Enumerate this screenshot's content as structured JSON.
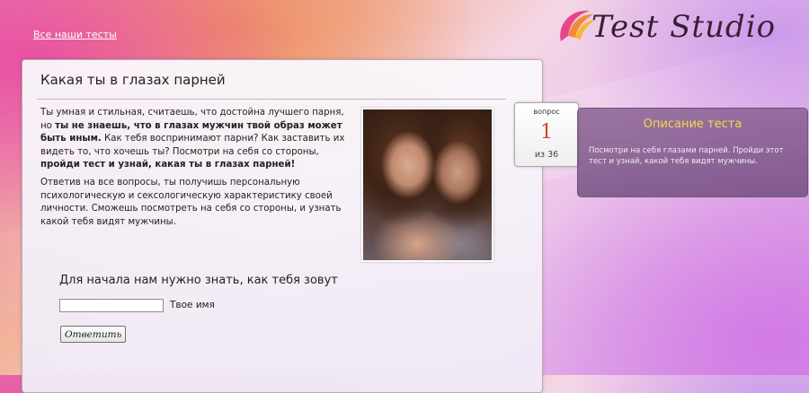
{
  "header": {
    "all_tests_link": "Все наши тесты",
    "logo_text": "Test Studio"
  },
  "main": {
    "title": "Какая ты в глазах парней",
    "intro_parts": [
      "Ты умная и стильная, считаешь, что достойна лучшего парня, но ",
      "ты не знаешь, что в глазах мужчин твой образ может быть иным.",
      " Как тебя воспринимают парни? Как заставить их видеть то, что хочешь ты? Посмотри на себя со стороны, ",
      "пройди тест и узнай, какая ты в глазах парней!"
    ],
    "intro2": "Ответив на все вопросы, ты получишь персональную психологическую и сексологическую характеристику своей личности. Сможешь посмотреть на себя со стороны, и узнать какой тебя видят мужчины.",
    "name_prompt": "Для начала нам нужно знать, как тебя зовут",
    "name_input_value": "",
    "name_label": "Твое имя",
    "submit_label": "Ответить"
  },
  "counter": {
    "label": "вопрос",
    "current": "1",
    "total": "из 36"
  },
  "description": {
    "title": "Описание теста",
    "text": "Посмотри на себя глазами парней. Пройди этот тест и узнай, какой тебя видят мужчины."
  },
  "colors": {
    "accent_red": "#d2412a",
    "desc_title": "#f5d84a",
    "desc_bg": "#7a5488"
  }
}
